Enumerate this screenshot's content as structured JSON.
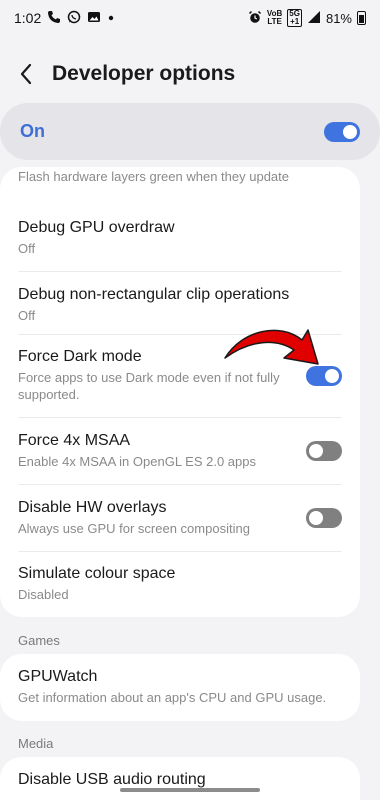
{
  "status_bar": {
    "time": "1:02",
    "battery_percent": "81%",
    "volte_top": "VoB",
    "volte_bottom": "LTE",
    "network_top": "5G",
    "network_bottom": "+1",
    "left_icons": [
      "phone-call-icon",
      "whatsapp-icon",
      "gallery-icon",
      "dot-icon"
    ],
    "right_icons": [
      "alarm-icon",
      "volte-icon",
      "network-5g-icon",
      "signal-icon",
      "battery-icon"
    ]
  },
  "header": {
    "title": "Developer options"
  },
  "master_switch": {
    "label": "On",
    "state": "on"
  },
  "settings": {
    "partial_item_text": "Flash hardware layers green when they update",
    "items": [
      {
        "title": "Debug GPU overdraw",
        "subtitle": "Off"
      },
      {
        "title": "Debug non-rectangular clip operations",
        "subtitle": "Off"
      },
      {
        "title": "Force Dark mode",
        "subtitle": "Force apps to use Dark mode even if not fully supported.",
        "toggle": "on"
      },
      {
        "title": "Force 4x MSAA",
        "subtitle": "Enable 4x MSAA in OpenGL ES 2.0 apps",
        "toggle": "off"
      },
      {
        "title": "Disable HW overlays",
        "subtitle": "Always use GPU for screen compositing",
        "toggle": "off"
      },
      {
        "title": "Simulate colour space",
        "subtitle": "Disabled"
      }
    ]
  },
  "games_section": {
    "label": "Games",
    "item": {
      "title": "GPUWatch",
      "subtitle": "Get information about an app's CPU and GPU usage."
    }
  },
  "media_section": {
    "label": "Media",
    "item": {
      "title": "Disable USB audio routing"
    }
  },
  "colors": {
    "accent": "#3e73e0",
    "toggle_off": "#808080",
    "annotation_arrow": "#e00000"
  }
}
